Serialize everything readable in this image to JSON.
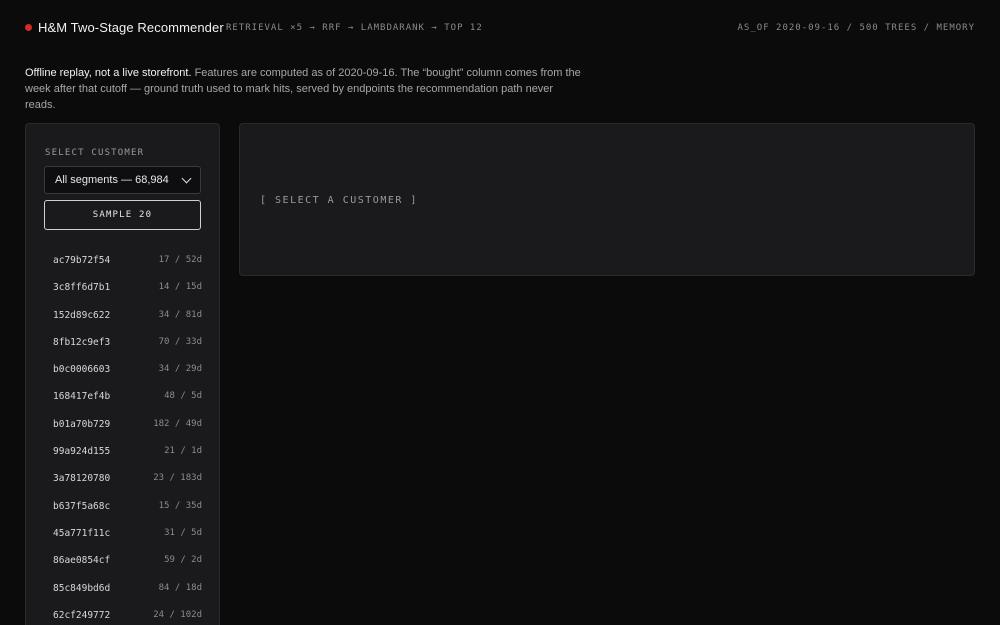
{
  "header": {
    "title": "H&M Two-Stage Recommender",
    "pipeline": "RETRIEVAL ×5 → RRF → LAMBDARANK → TOP 12",
    "meta": "AS_OF 2020-09-16 / 500 TREES / MEMORY",
    "accent_color": "#d42a2a"
  },
  "intro": {
    "lead": "Offline replay, not a live storefront.",
    "body": " Features are computed as of 2020-09-16. The “bought” column comes from the week after that cutoff — ground truth used to mark hits, served by endpoints the recommendation path never reads."
  },
  "sidebar": {
    "label": "SELECT CUSTOMER",
    "segment_selected": "All segments — 68,984",
    "sample_label": "SAMPLE 20",
    "customers": [
      {
        "id": "ac79b72f54",
        "stat": "17 / 52d"
      },
      {
        "id": "3c8ff6d7b1",
        "stat": "14 / 15d"
      },
      {
        "id": "152d89c622",
        "stat": "34 / 81d"
      },
      {
        "id": "8fb12c9ef3",
        "stat": "70 / 33d"
      },
      {
        "id": "b0c0006603",
        "stat": "34 / 29d"
      },
      {
        "id": "168417ef4b",
        "stat": "48 / 5d"
      },
      {
        "id": "b01a70b729",
        "stat": "182 / 49d"
      },
      {
        "id": "99a924d155",
        "stat": "21 / 1d"
      },
      {
        "id": "3a78120780",
        "stat": "23 / 183d"
      },
      {
        "id": "b637f5a68c",
        "stat": "15 / 35d"
      },
      {
        "id": "45a771f11c",
        "stat": "31 / 5d"
      },
      {
        "id": "86ae0854cf",
        "stat": "59 / 2d"
      },
      {
        "id": "85c849bd6d",
        "stat": "84 / 18d"
      },
      {
        "id": "62cf249772",
        "stat": "24 / 102d"
      }
    ]
  },
  "panel": {
    "empty_message": "[ SELECT A CUSTOMER ]"
  }
}
